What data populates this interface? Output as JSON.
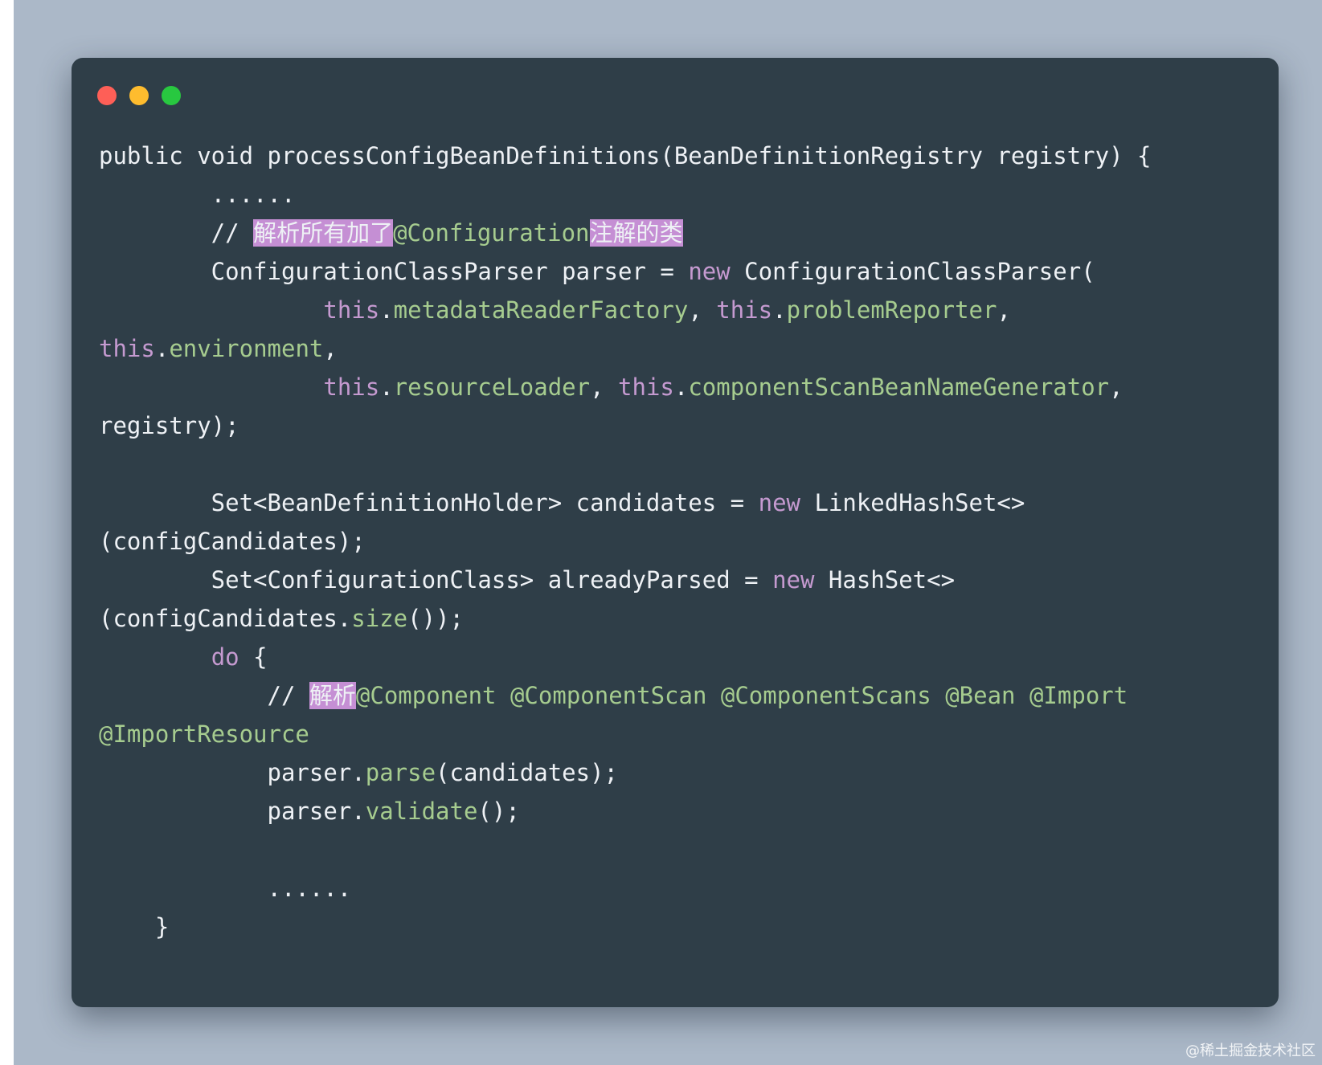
{
  "window": {
    "controls": [
      "close",
      "minimize",
      "maximize"
    ]
  },
  "code": {
    "l1": "public void processConfigBeanDefinitions(BeanDefinitionRegistry registry) {",
    "l2": "        ......",
    "l3_prefix": "        // ",
    "l3_hl1": "解析所有加了",
    "l3_mid": "@Configuration",
    "l3_hl2": "注解的类",
    "l4_a": "        ConfigurationClassParser parser = ",
    "l4_kw": "new",
    "l4_b": " ConfigurationClassParser(",
    "l5_indent": "                ",
    "l5_this1": "this",
    "l5_dot1": ".",
    "l5_f1": "metadataReaderFactory",
    "l5_sep": ", ",
    "l5_this2": "this",
    "l5_dot2": ".",
    "l5_f2": "problemReporter",
    "l5_end": ",",
    "l6_this": "this",
    "l6_dot": ".",
    "l6_f": "environment",
    "l6_end": ",",
    "l7_indent": "                ",
    "l7_this1": "this",
    "l7_dot1": ".",
    "l7_f1": "resourceLoader",
    "l7_sep": ", ",
    "l7_this2": "this",
    "l7_dot2": ".",
    "l7_f2": "componentScanBeanNameGenerator",
    "l7_end": ",",
    "l8": "registry);",
    "l10_a": "        Set<BeanDefinitionHolder> candidates = ",
    "l10_kw": "new",
    "l10_b": " LinkedHashSet<>",
    "l11": "(configCandidates);",
    "l12_a": "        Set<ConfigurationClass> alreadyParsed = ",
    "l12_kw": "new",
    "l12_b": " HashSet<>",
    "l13_a": "(configCandidates.",
    "l13_fn": "size",
    "l13_b": "());",
    "l14_indent": "        ",
    "l14_kw": "do",
    "l14_b": " {",
    "l15_prefix": "            // ",
    "l15_hl": "解析",
    "l15_rest": "@Component @ComponentScan @ComponentScans @Bean @Import",
    "l16": "@ImportResource",
    "l17_a": "            parser.",
    "l17_fn": "parse",
    "l17_b": "(candidates);",
    "l18_a": "            parser.",
    "l18_fn": "validate",
    "l18_b": "();",
    "l20": "            ......",
    "l21": "    }"
  },
  "watermark": "@稀土掘金技术社区"
}
